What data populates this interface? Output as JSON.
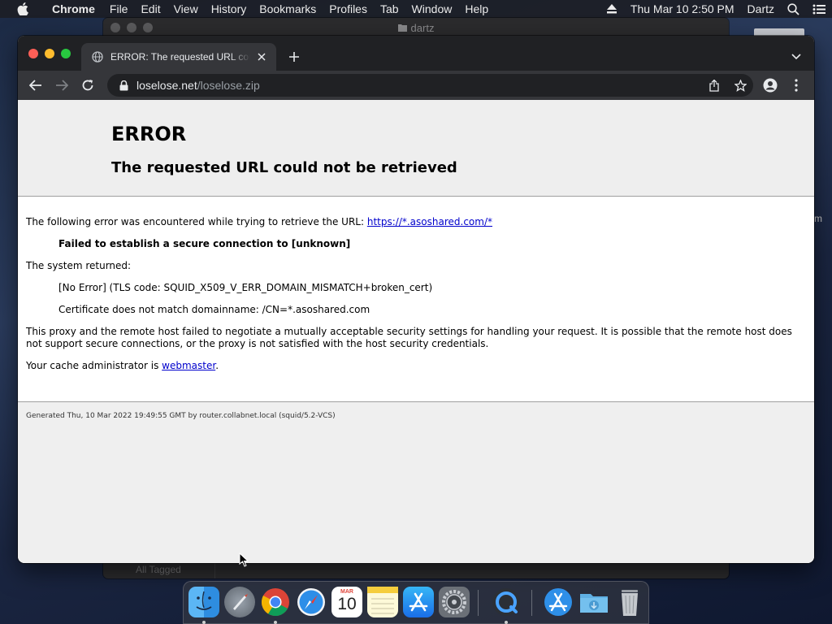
{
  "menubar": {
    "app_name": "Chrome",
    "items": [
      "File",
      "Edit",
      "View",
      "History",
      "Bookmarks",
      "Profiles",
      "Tab",
      "Window",
      "Help"
    ],
    "datetime": "Thu Mar 10  2:50 PM",
    "user": "Dartz"
  },
  "background_window": {
    "title": "dartz",
    "bottom_label": "All Tagged"
  },
  "desktop": {
    "side_text": "m"
  },
  "browser": {
    "tab_title": "ERROR: The requested URL could not be retrieved",
    "url_host": "loselose.net",
    "url_path": "/loselose.zip"
  },
  "page": {
    "heading": "ERROR",
    "subheading": "The requested URL could not be retrieved",
    "intro_text": "The following error was encountered while trying to retrieve the URL: ",
    "intro_link": "https://*.asoshared.com/*",
    "error_detail": "Failed to establish a secure connection to [unknown]",
    "system_returned": "The system returned:",
    "tls_code": "[No Error] (TLS code: SQUID_X509_V_ERR_DOMAIN_MISMATCH+broken_cert)",
    "cert_msg": "Certificate does not match domainname: /CN=*.asoshared.com",
    "explanation": "This proxy and the remote host failed to negotiate a mutually acceptable security settings for handling your request. It is possible that the remote host does not support secure connections, or the proxy is not satisfied with the host security credentials.",
    "admin_prefix": "Your cache administrator is ",
    "admin_link": "webmaster",
    "admin_suffix": ".",
    "footer": "Generated Thu, 10 Mar 2022 19:49:55 GMT by router.collabnet.local (squid/5.2-VCS)"
  },
  "dock": {
    "calendar_month": "MAR",
    "calendar_day": "10",
    "items": [
      "finder-icon",
      "launchpad-icon",
      "chrome-icon",
      "safari-icon",
      "calendar-icon",
      "notes-icon",
      "app-store-icon",
      "system-preferences-icon",
      "quicktime-icon",
      "applications-folder-icon",
      "downloads-folder-icon",
      "trash-icon"
    ]
  },
  "colors": {
    "link": "#0000cc",
    "traffic_red": "#ff5f57",
    "traffic_yellow": "#febc2e",
    "traffic_green": "#28c840"
  }
}
